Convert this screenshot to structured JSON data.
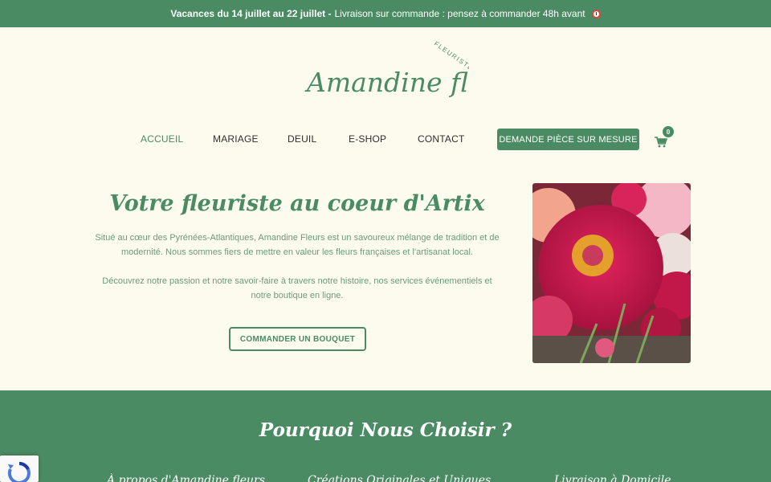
{
  "announcement": {
    "bold": "Vacances du 14 juillet au 22 juillet -",
    "text": "Livraison sur commande : pensez à commander 48h avant",
    "icon": "alarm-clock-icon"
  },
  "brand": {
    "name": "Amandine fleurs",
    "tagline": "FLEURISTE"
  },
  "nav": {
    "items": [
      {
        "label": "ACCUEIL",
        "active": true
      },
      {
        "label": "MARIAGE"
      },
      {
        "label": "DEUIL"
      },
      {
        "label": "E-SHOP"
      },
      {
        "label": "CONTACT"
      }
    ],
    "cta": "DEMANDE PIÈCE SUR MESURE",
    "cart_count": "0"
  },
  "hero": {
    "title": "Votre fleuriste au coeur d'Artix",
    "p1": "Situé au cœur des Pyrénées-Atlantiques, Amandine Fleurs est un savoureux mélange de tradition et de modernité. Nous sommes fiers de mettre en valeur les fleurs françaises et l'artisanat local.",
    "p2": "Découvrez notre passion et notre savoir-faire à travers notre histoire, nos services événementiels et notre boutique en ligne.",
    "button": "COMMANDER UN BOUQUET"
  },
  "why": {
    "title": "Pourquoi Nous Choisir ?",
    "features": [
      "À propos d'Amandine fleurs",
      "Créations Originales et Uniques",
      "Livraison à Domicile"
    ]
  },
  "colors": {
    "primary": "#4a8b63",
    "background": "#fdfbee"
  }
}
